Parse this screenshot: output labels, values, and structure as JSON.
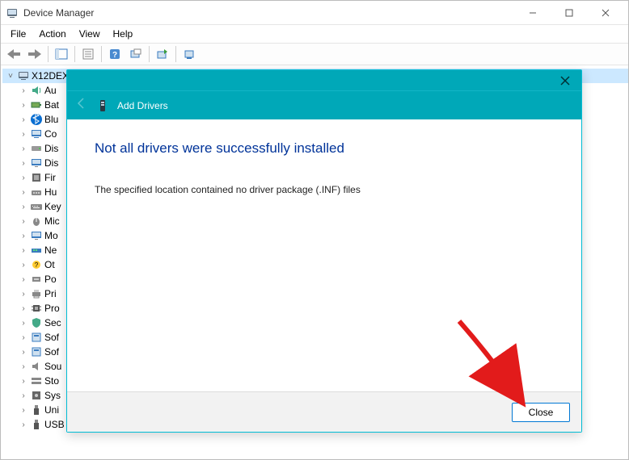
{
  "window": {
    "title": "Device Manager",
    "menus": [
      "File",
      "Action",
      "View",
      "Help"
    ]
  },
  "tree": {
    "root": "X12DEX",
    "items": [
      {
        "label": "Au",
        "icon": "speaker"
      },
      {
        "label": "Bat",
        "icon": "battery"
      },
      {
        "label": "Blu",
        "icon": "bluetooth"
      },
      {
        "label": "Co",
        "icon": "computer"
      },
      {
        "label": "Dis",
        "icon": "disk"
      },
      {
        "label": "Dis",
        "icon": "display"
      },
      {
        "label": "Fir",
        "icon": "firmware"
      },
      {
        "label": "Hu",
        "icon": "hid"
      },
      {
        "label": "Key",
        "icon": "keyboard"
      },
      {
        "label": "Mic",
        "icon": "mouse"
      },
      {
        "label": "Mo",
        "icon": "monitor"
      },
      {
        "label": "Ne",
        "icon": "network"
      },
      {
        "label": "Ot",
        "icon": "other"
      },
      {
        "label": "Po",
        "icon": "port"
      },
      {
        "label": "Pri",
        "icon": "printer"
      },
      {
        "label": "Pro",
        "icon": "processor"
      },
      {
        "label": "Sec",
        "icon": "security"
      },
      {
        "label": "Sof",
        "icon": "software"
      },
      {
        "label": "Sof",
        "icon": "software"
      },
      {
        "label": "Sou",
        "icon": "sound"
      },
      {
        "label": "Sto",
        "icon": "storage"
      },
      {
        "label": "Sys",
        "icon": "system"
      },
      {
        "label": "Uni",
        "icon": "usb"
      },
      {
        "label": "USB",
        "icon": "usb"
      }
    ]
  },
  "modal": {
    "header_label": "Add Drivers",
    "headline": "Not all drivers were successfully installed",
    "message": "The specified location contained no driver package (.INF) files",
    "close_button": "Close"
  }
}
